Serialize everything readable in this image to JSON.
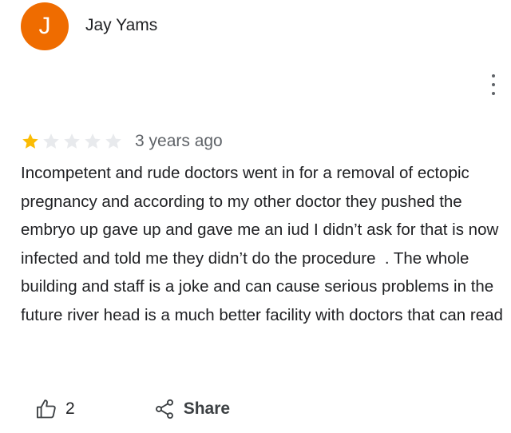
{
  "review": {
    "author": {
      "name": "Jay Yams",
      "initial": "J",
      "avatar_color": "#ef6c00"
    },
    "rating": 1,
    "rating_max": 5,
    "colors": {
      "star_filled": "#fbbc04",
      "star_empty": "#e8eaed"
    },
    "time_ago": "3 years ago",
    "text": "Incompetent and rude doctors went in for a removal of ectopic pregnancy and according to my other doctor they pushed the embryo up gave up and gave me an iud I didn’t ask for that is now infected and told me they didn’t do the procedure  . The whole building and staff is a joke and can cause serious problems in the future river head is a much better facility with doctors that can read"
  },
  "actions": {
    "like_icon": "thumb-up-icon",
    "like_count": "2",
    "share_icon": "share-icon",
    "share_label": "Share",
    "more_icon": "more-vert-icon"
  }
}
